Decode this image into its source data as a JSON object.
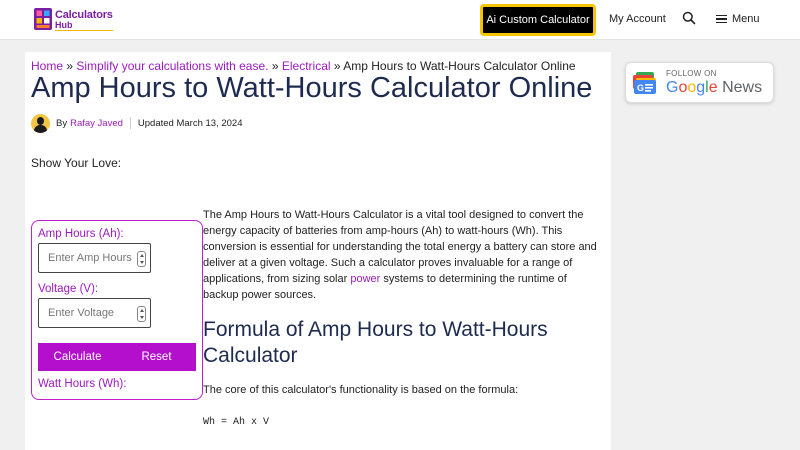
{
  "header": {
    "logo_line1": "Calculators",
    "logo_line2": "Hub",
    "cta_label": "Ai Custom Calculator",
    "account_label": "My Account",
    "menu_label": "Menu"
  },
  "breadcrumb": {
    "home": "Home",
    "sep": "»",
    "level1": "Simplify your calculations with ease.",
    "level2": "Electrical",
    "current": "Amp Hours to Watt-Hours Calculator Online"
  },
  "article": {
    "title": "Amp Hours to Watt-Hours Calculator Online",
    "by_label": "By",
    "author": "Rafay Javed",
    "updated": "Updated March 13, 2024",
    "show_love": "Show Your Love:",
    "intro_before": "The Amp Hours to Watt-Hours Calculator is a vital tool designed to convert the energy capacity of batteries from amp-hours (Ah) to watt-hours (Wh). This conversion is essential for understanding the total energy a battery can store and deliver at a given voltage. Such a calculator proves invaluable for a range of applications, from sizing solar ",
    "intro_link": "power",
    "intro_after": " systems to determining the runtime of backup power sources.",
    "formula_heading": "Formula of Amp Hours to Watt-Hours Calculator",
    "formula_intro": "The core of this calculator's functionality is based on the formula:",
    "formula_code": "Wh = Ah x V"
  },
  "calculator": {
    "amp_label": "Amp Hours (Ah):",
    "amp_placeholder": "Enter Amp Hours",
    "volt_label": "Voltage (V):",
    "volt_placeholder": "Enter Voltage",
    "calculate_label": "Calculate",
    "reset_label": "Reset",
    "result_label": "Watt Hours (Wh):"
  },
  "sidebar": {
    "follow_label": "FOLLOW ON",
    "brand_g1": "G",
    "brand_o1": "o",
    "brand_o2": "o",
    "brand_g2": "g",
    "brand_l": "l",
    "brand_e": "e",
    "brand_news": "News"
  },
  "colors": {
    "accent": "#9c1bbd",
    "button_bg": "#b40fcd",
    "title": "#1e2b4f",
    "cta_border": "#f5c500"
  },
  "icons": {
    "search": "search-icon",
    "menu": "hamburger-icon",
    "google_news": "google-news-icon"
  }
}
